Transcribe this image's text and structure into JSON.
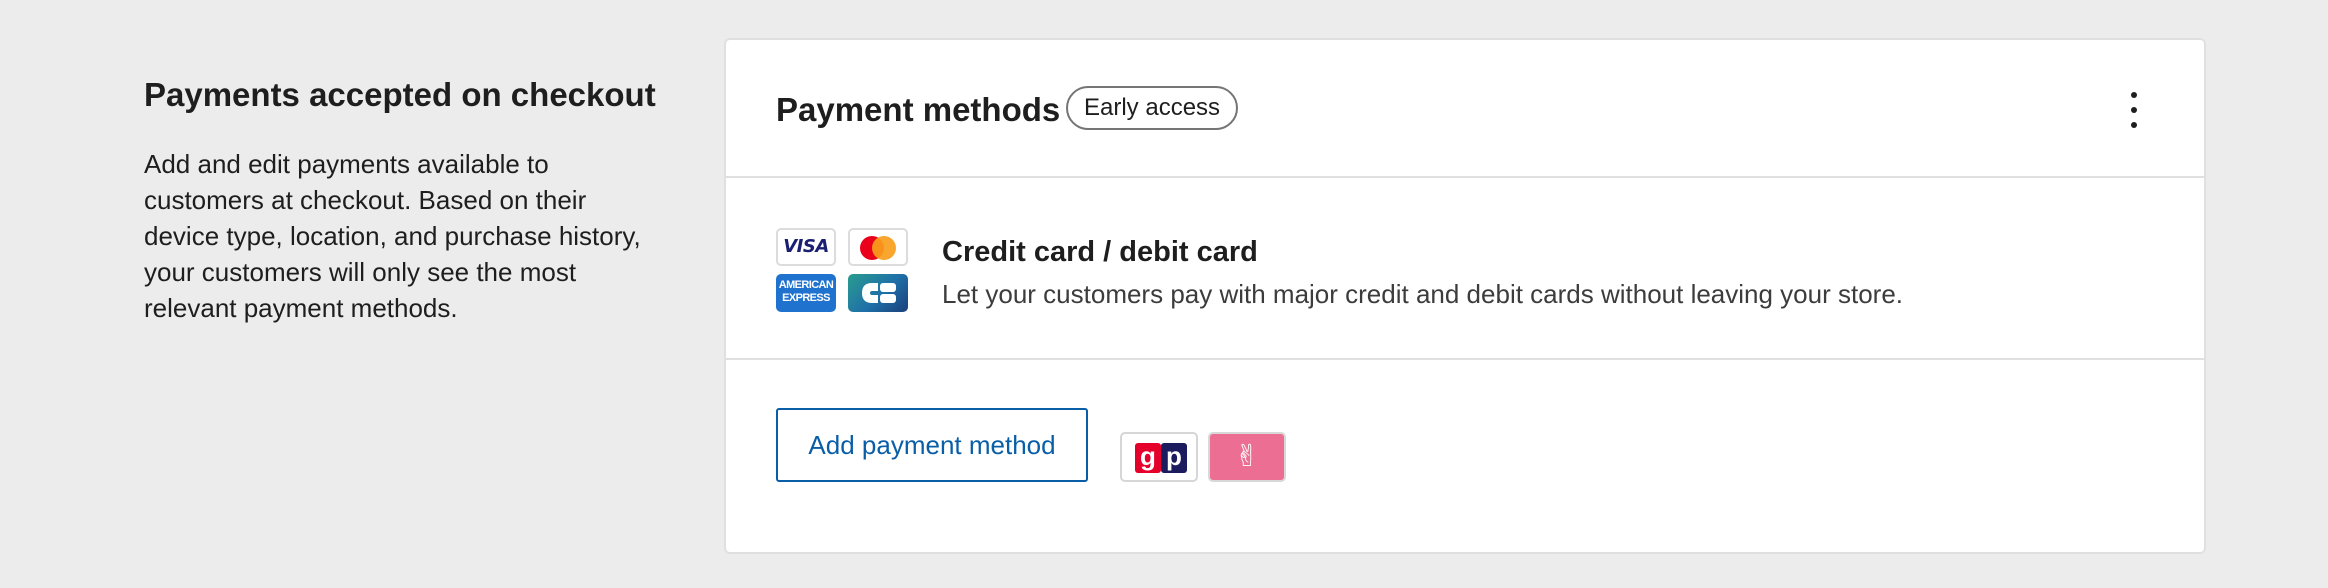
{
  "intro": {
    "title": "Payments accepted on checkout",
    "description": "Add and edit payments available to customers at checkout. Based on their device type, location, and purchase history, your customers will only see the most relevant payment methods."
  },
  "card": {
    "title": "Payment methods",
    "badge": "Early access",
    "menu_icon": "more-vertical-icon"
  },
  "methods": [
    {
      "title": "Credit card / debit card",
      "description": "Let your customers pay with major credit and debit cards without leaving your store.",
      "logos": [
        {
          "name": "visa",
          "text": "VISA",
          "color": "#1a1f71"
        },
        {
          "name": "mastercard",
          "colors": [
            "#eb001b",
            "#f79e1b"
          ]
        },
        {
          "name": "amex",
          "text": "AMERICAN EXPRESS",
          "color": "#1f72cd"
        },
        {
          "name": "cartes-bancaires",
          "color": "#1f6fa8"
        }
      ]
    }
  ],
  "footer": {
    "add_button_label": "Add payment method",
    "other_logos": [
      {
        "name": "giropay",
        "text_g": "g",
        "text_p": "p",
        "colors": [
          "#e4002b",
          "#1b1b5e"
        ]
      },
      {
        "name": "peace-hand",
        "glyph": "✌",
        "color": "#ec6f93"
      }
    ]
  },
  "colors": {
    "accent": "#0a5ea8",
    "background": "#ececec",
    "card_border": "#e0e0e0"
  }
}
